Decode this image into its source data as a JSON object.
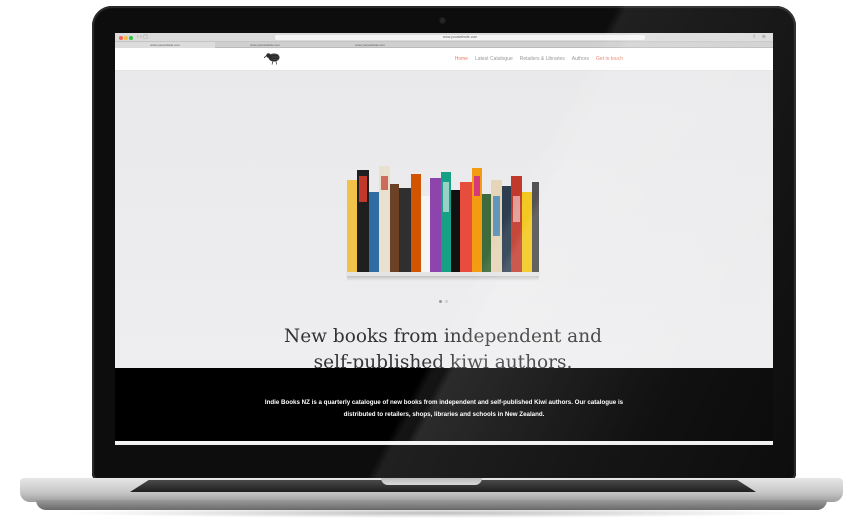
{
  "browser": {
    "url": "www.yourwebsite.com",
    "tabs": [
      "www.yourwebsite.com",
      "www.yourwebsite.com",
      "www.yourwebsite.com"
    ]
  },
  "nav": {
    "items": [
      {
        "label": "Home",
        "state": "active"
      },
      {
        "label": "Latest Catalogue",
        "state": "normal"
      },
      {
        "label": "Retailers & Libraries",
        "state": "normal"
      },
      {
        "label": "Authors",
        "state": "normal"
      },
      {
        "label": "Get in touch",
        "state": "cta"
      }
    ],
    "accent_color": "#e9826a"
  },
  "logo": {
    "icon": "kiwi-bird-icon"
  },
  "hero": {
    "image": "bookshelf-illustration",
    "carousel": {
      "slides": 2,
      "active": 1
    },
    "tagline_line1": "New books from independent and",
    "tagline_line2": "self-published kiwi authors."
  },
  "about": {
    "text": "Indie Books NZ is a quarterly catalogue of new books from independent and self-published Kiwi authors.  Our catalogue is distributed to retailers, shops, libraries and schools in New Zealand."
  }
}
